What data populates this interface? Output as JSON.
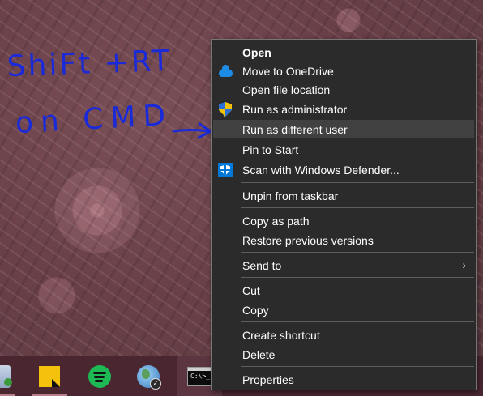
{
  "annotation": {
    "line1": "ShiFt +RT",
    "line2": "on CMD",
    "arrow": "→",
    "color": "#1a2ad8"
  },
  "context_menu": {
    "items": [
      {
        "label": "Open",
        "bold": true,
        "icon": null
      },
      {
        "label": "Move to OneDrive",
        "icon": "onedrive-icon"
      },
      {
        "label": "Open file location",
        "icon": null
      },
      {
        "label": "Run as administrator",
        "icon": "uac-shield-icon"
      },
      {
        "label": "Run as different user",
        "icon": null,
        "highlighted": true
      },
      {
        "label": "Pin to Start",
        "icon": null
      },
      {
        "label": "Scan with Windows Defender...",
        "icon": "windows-defender-icon"
      },
      {
        "label": "Unpin from taskbar",
        "icon": null
      },
      {
        "label": "Copy as path",
        "icon": null
      },
      {
        "label": "Restore previous versions",
        "icon": null
      },
      {
        "label": "Send to",
        "icon": null,
        "submenu": true,
        "arrow": "›"
      },
      {
        "label": "Cut",
        "icon": null
      },
      {
        "label": "Copy",
        "icon": null
      },
      {
        "label": "Create shortcut",
        "icon": null
      },
      {
        "label": "Delete",
        "icon": null
      },
      {
        "label": "Properties",
        "icon": null
      }
    ]
  },
  "taskbar": {
    "items": [
      {
        "name": "partial-app-icon"
      },
      {
        "name": "sticky-notes-icon"
      },
      {
        "name": "spotify-icon"
      },
      {
        "name": "network-globe-icon"
      },
      {
        "name": "command-prompt-icon",
        "active": true
      }
    ],
    "cmd_prompt_glyph": "C:\\>_"
  },
  "colors": {
    "menu_background": "#2b2b2b",
    "menu_highlight": "#414141",
    "taskbar": "#4a2630"
  }
}
